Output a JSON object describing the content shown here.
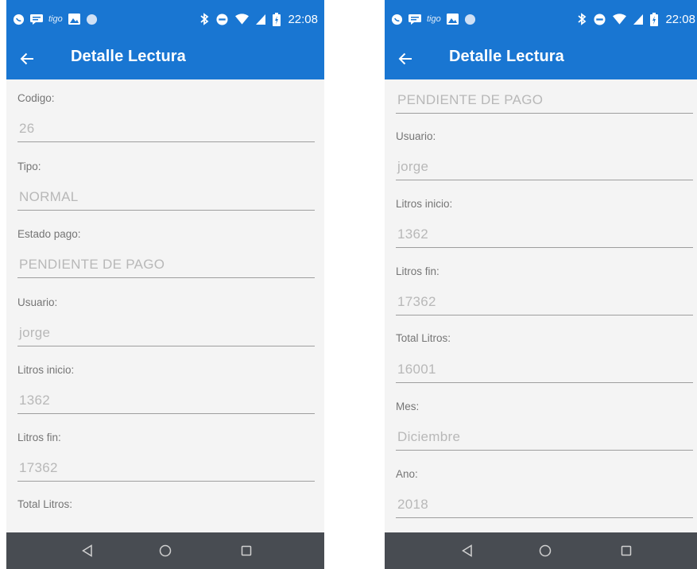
{
  "app": {
    "title": "Detalle Lectura"
  },
  "status_bar": {
    "time": "22:08",
    "carrier": "tigo"
  },
  "screens": [
    {
      "fields": [
        {
          "label": "Codigo:",
          "value": "26"
        },
        {
          "label": "Tipo:",
          "value": "NORMAL"
        },
        {
          "label": "Estado pago:",
          "value": "PENDIENTE DE PAGO"
        },
        {
          "label": "Usuario:",
          "value": "jorge"
        },
        {
          "label": "Litros inicio:",
          "value": "1362"
        },
        {
          "label": "Litros fin:",
          "value": "17362"
        },
        {
          "label": "Total Litros:",
          "value": ""
        }
      ]
    },
    {
      "fields": [
        {
          "label": "",
          "value": "PENDIENTE DE PAGO"
        },
        {
          "label": "Usuario:",
          "value": "jorge"
        },
        {
          "label": "Litros inicio:",
          "value": "1362"
        },
        {
          "label": "Litros fin:",
          "value": "17362"
        },
        {
          "label": "Total Litros:",
          "value": "16001"
        },
        {
          "label": "Mes:",
          "value": "Diciembre"
        },
        {
          "label": "Ano:",
          "value": "2018"
        }
      ]
    }
  ],
  "icons": {
    "back": "arrow-left-icon",
    "nav_back": "triangle-back-icon",
    "nav_home": "circle-home-icon",
    "nav_recents": "square-recents-icon"
  },
  "colors": {
    "primary": "#1976d2",
    "background": "#f4f4f4",
    "label": "#757575",
    "value": "#b8b8b8",
    "underline": "#9e9e9e",
    "navbar": "#484c52"
  }
}
